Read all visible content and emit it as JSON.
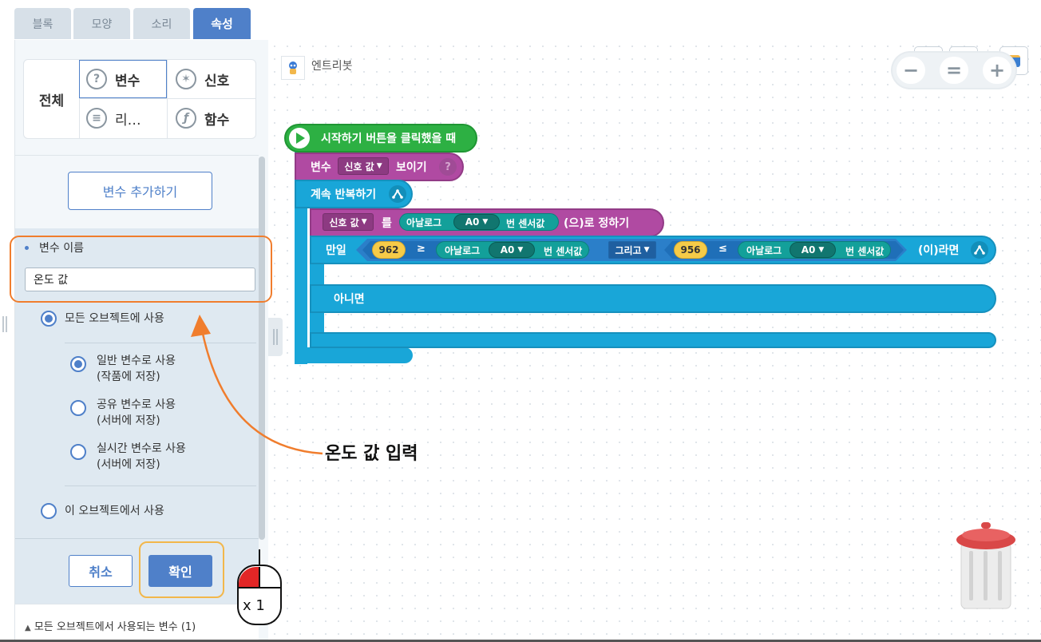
{
  "tabs": [
    {
      "label": "블록",
      "active": false
    },
    {
      "label": "모양",
      "active": false
    },
    {
      "label": "소리",
      "active": false
    },
    {
      "label": "속성",
      "active": true
    }
  ],
  "sidebar": {
    "all_label": "전체",
    "categories": [
      {
        "label": "변수",
        "icon": "question-icon"
      },
      {
        "label": "신호",
        "icon": "signal-icon"
      },
      {
        "label": "리…",
        "icon": "list-icon"
      },
      {
        "label": "함수",
        "icon": "function-icon"
      }
    ],
    "add_variable_label": "변수 추가하기",
    "var_name_label": "변수 이름",
    "var_name_value": "온도 값",
    "scope_all": "모든 오브젝트에 사용",
    "normal_var": {
      "line1": "일반 변수로 사용",
      "line2": "(작품에 저장)"
    },
    "shared_var": {
      "line1": "공유 변수로 사용",
      "line2": "(서버에 저장)"
    },
    "realtime_var": {
      "line1": "실시간 변수로 사용",
      "line2": "(서버에 저장)"
    },
    "scope_this": "이 오브젝트에서 사용",
    "cancel_label": "취소",
    "ok_label": "확인",
    "all_objects_vars": "모든 오브젝트에서 사용되는 변수 (1)"
  },
  "canvas": {
    "object_name": "엔트리봇",
    "zoom": {
      "minus": "−",
      "reset": "=",
      "plus": "+"
    }
  },
  "blocks": {
    "start": "시작하기 버튼을 클릭했을 때",
    "show_var_prefix": "변수",
    "show_var_name": "신호 값",
    "show_var_suffix": "보이기",
    "loop": "계속 반복하기",
    "set_var_name": "신호 값",
    "set_var_mid": "를",
    "analog": "아날로그",
    "port": "A0",
    "sensor_suffix": "번 센서값",
    "set_var_suffix": "(으)로 정하기",
    "if_label": "만일",
    "num1": "962",
    "op1": "≥",
    "and_label": "그리고",
    "num2": "956",
    "op2": "≤",
    "then_label": "(이)라면",
    "else_label": "아니면"
  },
  "annotation": {
    "label": "온도 값 입력",
    "click_count": "x 1"
  },
  "colors": {
    "accent": "#4f80c9",
    "callout_orange": "#f07d2d",
    "callout_yellow": "#f2b74b",
    "start_green": "#2db043",
    "variable_purple": "#b04aa2",
    "flow_blue": "#19a6d8"
  }
}
